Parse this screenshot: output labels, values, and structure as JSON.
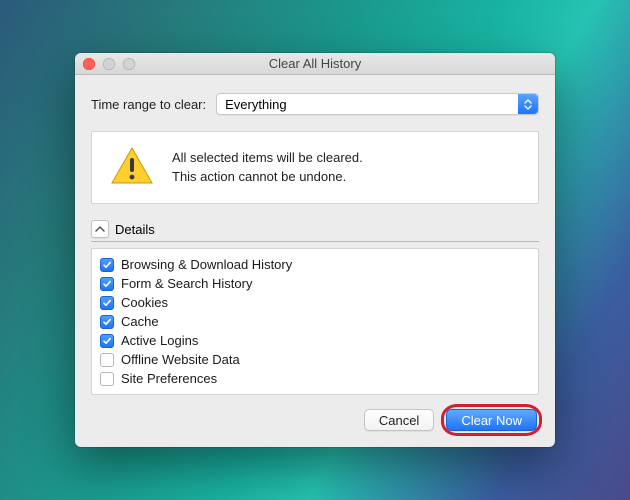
{
  "window": {
    "title": "Clear All History"
  },
  "timerange": {
    "label": "Time range to clear:",
    "value": "Everything"
  },
  "warning": {
    "line1": "All selected items will be cleared.",
    "line2": "This action cannot be undone."
  },
  "details": {
    "label": "Details",
    "expanded": true
  },
  "checklist": [
    {
      "label": "Browsing & Download History",
      "checked": true
    },
    {
      "label": "Form & Search History",
      "checked": true
    },
    {
      "label": "Cookies",
      "checked": true
    },
    {
      "label": "Cache",
      "checked": true
    },
    {
      "label": "Active Logins",
      "checked": true
    },
    {
      "label": "Offline Website Data",
      "checked": false
    },
    {
      "label": "Site Preferences",
      "checked": false
    }
  ],
  "buttons": {
    "cancel": "Cancel",
    "clear": "Clear Now"
  },
  "colors": {
    "accent": "#1e74f6",
    "highlight": "#d2202f"
  }
}
